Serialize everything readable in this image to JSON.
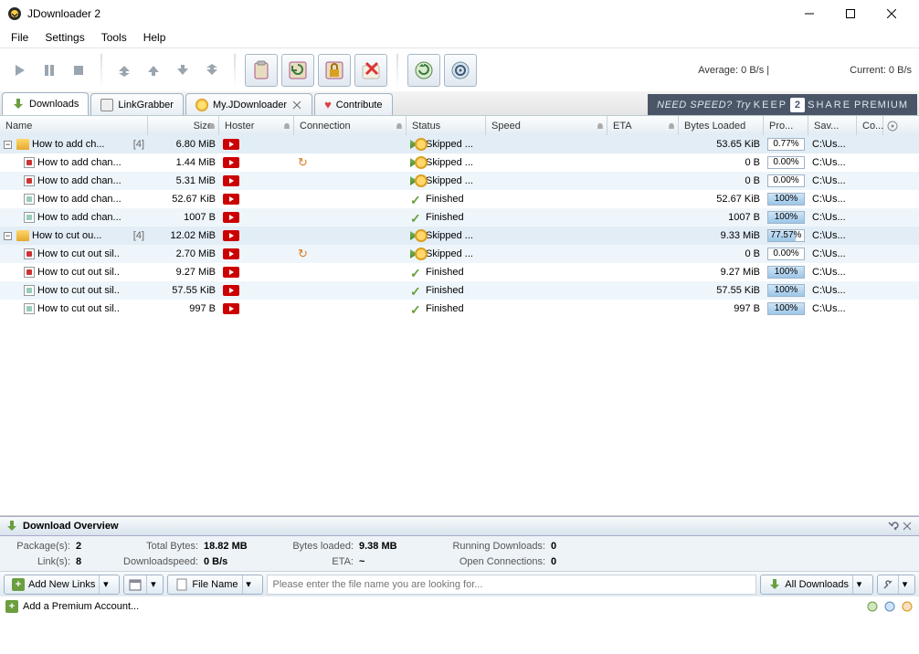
{
  "window": {
    "title": "JDownloader 2"
  },
  "menu": {
    "file": "File",
    "settings": "Settings",
    "tools": "Tools",
    "help": "Help"
  },
  "toolbar": {
    "avg_label": "Average: 0 B/s |",
    "current_label": "Current: 0 B/s"
  },
  "tabs": {
    "downloads": "Downloads",
    "linkgrabber": "LinkGrabber",
    "myjd": "My.JDownloader",
    "contribute": "Contribute"
  },
  "banner": {
    "a": "NEED SPEED? Try",
    "b": "KEEP",
    "n": "2",
    "c": "SHARE",
    "d": "PREMIUM"
  },
  "columns": {
    "name": "Name",
    "size": "Size",
    "hoster": "Hoster",
    "connection": "Connection",
    "status": "Status",
    "speed": "Speed",
    "eta": "ETA",
    "bytes": "Bytes Loaded",
    "progress": "Pro...",
    "save": "Sav...",
    "comment": "Co..."
  },
  "rows": [
    {
      "type": "pkg",
      "name": "How to add ch...",
      "count": "[4]",
      "size": "6.80 MiB",
      "status": "Skipped ...",
      "icon": "skip",
      "bytes": "53.65 KiB",
      "prog": "0.77%",
      "pct": 0.77,
      "save": "C:\\Us..."
    },
    {
      "type": "item",
      "ftype": "v",
      "name": "How to add chan...",
      "size": "1.44 MiB",
      "conn": "retry",
      "status": "Skipped ...",
      "icon": "skip",
      "bytes": "0 B",
      "prog": "0.00%",
      "pct": 0,
      "save": "C:\\Us..."
    },
    {
      "type": "item",
      "ftype": "v",
      "name": "How to add chan...",
      "size": "5.31 MiB",
      "status": "Skipped ...",
      "icon": "skip",
      "bytes": "0 B",
      "prog": "0.00%",
      "pct": 0,
      "save": "C:\\Us..."
    },
    {
      "type": "item",
      "ftype": "t",
      "name": "How to add chan...",
      "size": "52.67 KiB",
      "status": "Finished",
      "icon": "fin",
      "bytes": "52.67 KiB",
      "prog": "100%",
      "pct": 100,
      "save": "C:\\Us..."
    },
    {
      "type": "item",
      "ftype": "t",
      "name": "How to add chan...",
      "size": "1007 B",
      "status": "Finished",
      "icon": "fin",
      "bytes": "1007 B",
      "prog": "100%",
      "pct": 100,
      "save": "C:\\Us..."
    },
    {
      "type": "pkg",
      "name": "How to cut ou...",
      "count": "[4]",
      "size": "12.02 MiB",
      "status": "Skipped ...",
      "icon": "skip",
      "bytes": "9.33 MiB",
      "prog": "77.57%",
      "pct": 77.57,
      "save": "C:\\Us..."
    },
    {
      "type": "item",
      "ftype": "v",
      "name": "How to cut out sil..",
      "size": "2.70 MiB",
      "conn": "retry",
      "status": "Skipped ...",
      "icon": "skip",
      "bytes": "0 B",
      "prog": "0.00%",
      "pct": 0,
      "save": "C:\\Us..."
    },
    {
      "type": "item",
      "ftype": "v",
      "name": "How to cut out sil..",
      "size": "9.27 MiB",
      "status": "Finished",
      "icon": "fin",
      "bytes": "9.27 MiB",
      "prog": "100%",
      "pct": 100,
      "save": "C:\\Us..."
    },
    {
      "type": "item",
      "ftype": "t",
      "name": "How to cut out sil..",
      "size": "57.55 KiB",
      "status": "Finished",
      "icon": "fin",
      "bytes": "57.55 KiB",
      "prog": "100%",
      "pct": 100,
      "save": "C:\\Us..."
    },
    {
      "type": "item",
      "ftype": "t",
      "name": "How to cut out sil..",
      "size": "997 B",
      "status": "Finished",
      "icon": "fin",
      "bytes": "997 B",
      "prog": "100%",
      "pct": 100,
      "save": "C:\\Us..."
    }
  ],
  "overview": {
    "title": "Download Overview",
    "packages_lbl": "Package(s):",
    "packages": "2",
    "links_lbl": "Link(s):",
    "links": "8",
    "totalbytes_lbl": "Total Bytes:",
    "totalbytes": "18.82 MB",
    "dlspeed_lbl": "Downloadspeed:",
    "dlspeed": "0 B/s",
    "bytesloaded_lbl": "Bytes loaded:",
    "bytesloaded": "9.38 MB",
    "eta_lbl": "ETA:",
    "eta": "~",
    "running_lbl": "Running Downloads:",
    "running": "0",
    "openconn_lbl": "Open Connections:",
    "openconn": "0"
  },
  "bottom": {
    "addlinks": "Add New Links",
    "searchlabel": "File Name",
    "searchplaceholder": "Please enter the file name you are looking for...",
    "alldl": "All Downloads"
  },
  "status": {
    "premium": "Add a Premium Account..."
  }
}
